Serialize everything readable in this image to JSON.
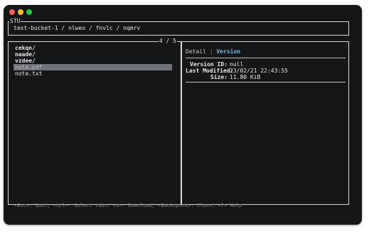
{
  "breadcrumb": {
    "title": "STU",
    "path": "test-bucket-1 / nlweo / fnvlc / nqmrv"
  },
  "list": {
    "counter": "4 / 5",
    "items": [
      {
        "label": "cekqn/"
      },
      {
        "label": "naade/"
      },
      {
        "label": "vzdee/"
      },
      {
        "label": "note.pdf",
        "selected": true
      },
      {
        "label": "note.txt"
      }
    ]
  },
  "detail": {
    "tabs": [
      {
        "label": "Detail"
      },
      {
        "label": "Version",
        "active": true
      }
    ],
    "properties": [
      {
        "key": "Version ID:",
        "value": "null"
      },
      {
        "key": "Last Modified:",
        "value": "23/02/21 22:43:55"
      },
      {
        "key": "Size:",
        "value": "11.80 KiB"
      }
    ]
  },
  "footer": {
    "help": "<Esc>: Quit, <h/l>: Select tabs, <s>: Download, <Backspace>: Close, <?> Help"
  },
  "colors": {
    "background": "#151617",
    "border": "#d9d9d9",
    "selection": "#6f7279",
    "active_tab": "#7ab8d8",
    "help_text": "#7f7f7f"
  }
}
